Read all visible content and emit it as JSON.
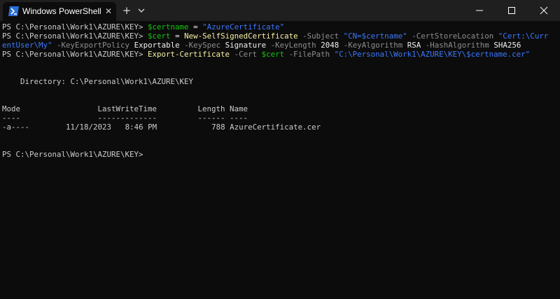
{
  "window": {
    "tab_title": "Windows PowerShell",
    "close_tab_glyph": "✕",
    "new_tab_glyph": "+"
  },
  "terminal": {
    "prompt": "PS C:\\Personal\\Work1\\AZURE\\KEY>",
    "cmd1": {
      "var": "$certname",
      "op": "=",
      "str": "\"AzureCertificate\""
    },
    "cmd2": {
      "var": "$cert",
      "op": "=",
      "cmdlet": "New-SelfSignedCertificate",
      "p_subject": "-Subject",
      "v_subject": "\"CN=$certname\"",
      "p_store": "-CertStoreLocation",
      "v_store_a": "\"Cert:\\Curr",
      "v_store_b": "entUser\\My\"",
      "p_export": "-KeyExportPolicy",
      "v_export": "Exportable",
      "p_spec": "-KeySpec",
      "v_spec": "Signature",
      "p_length": "-KeyLength",
      "v_length": "2048",
      "p_alg": "-KeyAlgorithm",
      "v_alg": "RSA",
      "p_hash": "-HashAlgorithm",
      "v_hash": "SHA256"
    },
    "cmd3": {
      "cmdlet": "Export-Certificate",
      "p_cert": "-Cert",
      "v_cert": "$cert",
      "p_path": "-FilePath",
      "v_path": "\"C:\\Personal\\Work1\\AZURE\\KEY\\$certname.cer\""
    },
    "directory_line": "    Directory: C:\\Personal\\Work1\\AZURE\\KEY",
    "header_line": "Mode                 LastWriteTime         Length Name",
    "underline_line": "----                 -------------         ------ ----",
    "file_row": {
      "mode": "-a----",
      "date": "11/18/2023",
      "time": "8:46 PM",
      "length": "788",
      "name": "AzureCertificate.cer"
    },
    "final_prompt": "PS C:\\Personal\\Work1\\AZURE\\KEY>"
  },
  "colors": {
    "background": "#0c0c0c",
    "titlebar": "#1f1f1f",
    "command": "#f9f1a5",
    "variable": "#16c60c",
    "string": "#3b78ff",
    "parameter": "#8e8e8e",
    "text": "#cccccc"
  },
  "icons": [
    "powershell-icon",
    "close-icon",
    "new-tab-icon",
    "chevron-down-icon",
    "minimize-icon",
    "maximize-icon",
    "window-close-icon"
  ]
}
